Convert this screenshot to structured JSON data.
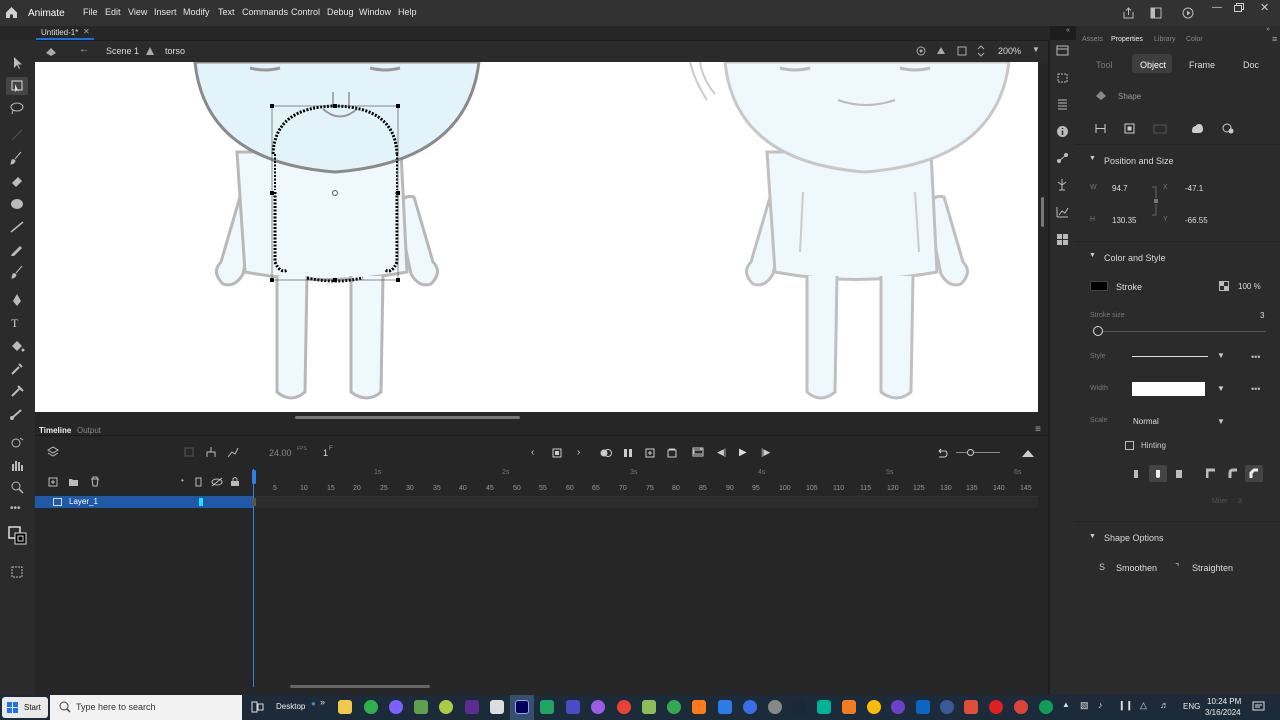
{
  "app": {
    "name": "Animate"
  },
  "menu": [
    "File",
    "Edit",
    "View",
    "Insert",
    "Modify",
    "Text",
    "Commands",
    "Control",
    "Debug",
    "Window",
    "Help"
  ],
  "document": {
    "tab_title": "Untitled-1*",
    "scene": "Scene 1",
    "symbol": "torso",
    "zoom": "200%"
  },
  "timeline": {
    "tabs": [
      "Timeline",
      "Output"
    ],
    "fps": "24.00",
    "fps_unit": "FPS",
    "frame": "1",
    "frame_unit": "F",
    "layer": "Layer_1",
    "ruler_ticks": [
      "5",
      "10",
      "15",
      "20",
      "25",
      "30",
      "35",
      "40",
      "45",
      "50",
      "55",
      "60",
      "65",
      "70",
      "75",
      "80",
      "85",
      "90",
      "95",
      "100",
      "105",
      "110",
      "115",
      "120",
      "125",
      "130",
      "135",
      "140",
      "145"
    ],
    "seconds": [
      "1s",
      "2s",
      "3s",
      "4s",
      "5s",
      "6s"
    ]
  },
  "properties": {
    "panel_tabs": [
      "Assets",
      "Properties",
      "Library",
      "Color"
    ],
    "subtabs": [
      "Tool",
      "Object",
      "Frame",
      "Doc"
    ],
    "object_type": "Shape",
    "position_size": {
      "title": "Position and Size",
      "w_label": "W",
      "w": "94.7",
      "h_label": "H",
      "h": "130.35",
      "x_label": "X",
      "x": "-47.1",
      "y_label": "Y",
      "y": "-66.55"
    },
    "color_style": {
      "title": "Color and Style",
      "stroke_label": "Stroke",
      "stroke_color": "#000000",
      "opacity": "100 %",
      "stroke_size_label": "Stroke size",
      "stroke_size": "3",
      "style_label": "Style",
      "width_label": "Width",
      "scale_label": "Scale",
      "scale": "Normal",
      "hinting": "Hinting",
      "miter_label": "Miter",
      "miter": "3"
    },
    "shape_options": {
      "title": "Shape Options",
      "smoothen": "Smoothen",
      "straighten": "Straighten"
    }
  },
  "taskbar": {
    "start": "Start",
    "search_placeholder": "Type here to search",
    "desktop": "Desktop",
    "lang": "ENG",
    "time": "10:24 PM",
    "date": "3/16/2024"
  },
  "colors": {
    "accent": "#1473e6",
    "selection_layer": "#1e5aa8",
    "bg": "#2b2b2b"
  }
}
